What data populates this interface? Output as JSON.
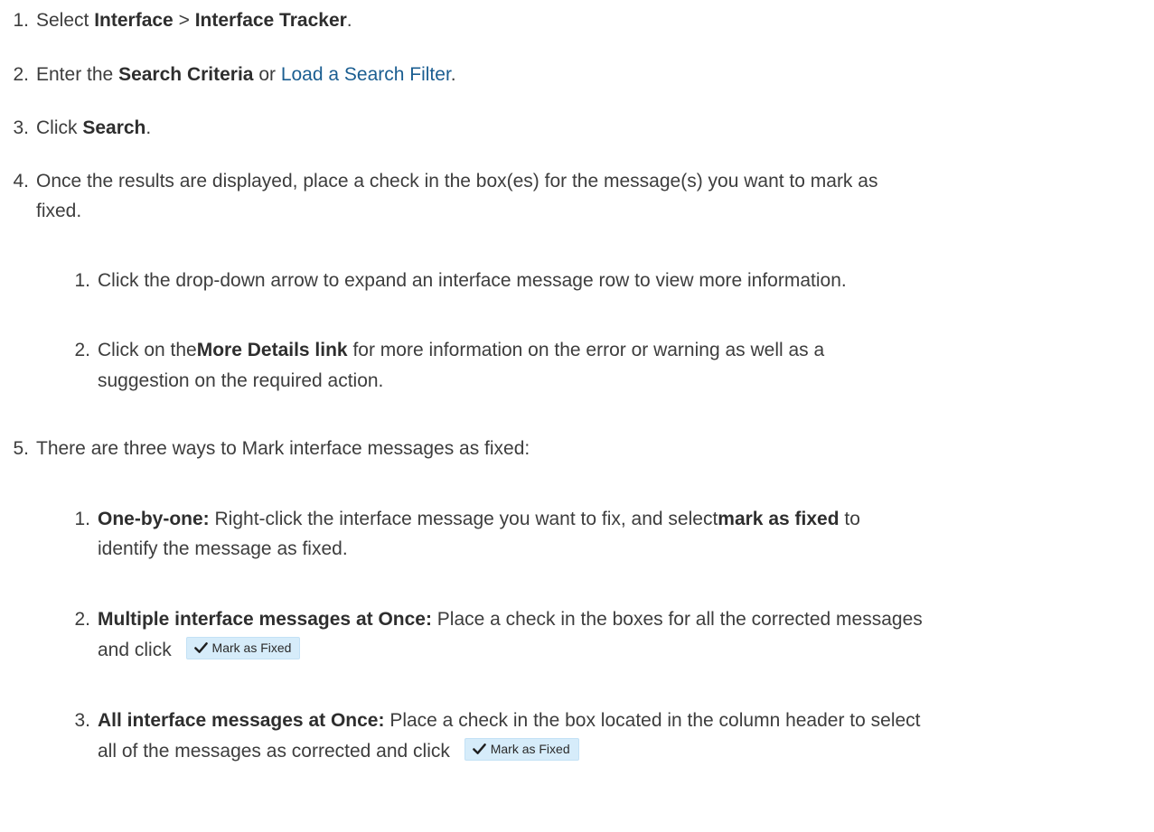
{
  "steps": [
    {
      "num": "1.",
      "pre": "Select ",
      "b1": "Interface",
      "mid": " > ",
      "b2": "Interface Tracker",
      "post": "."
    },
    {
      "num": "2.",
      "pre": "Enter the ",
      "b1": "Search Criteria",
      "mid": " or ",
      "link": "Load a Search Filter",
      "post": "."
    },
    {
      "num": "3.",
      "pre": "Click ",
      "b1": "Search",
      "post": "."
    },
    {
      "num": "4.",
      "line1": "Once the results are displayed, place a check in the box(es) for the message(s) you want to mark as",
      "line2": "fixed.",
      "sub": [
        {
          "num": "1.",
          "text": "Click the drop-down arrow to expand an interface message row to view more information."
        },
        {
          "num": "2.",
          "pre": "Click on the",
          "b1": "More Details link",
          "post1": " for more information on the error or warning as well as a",
          "line2": "suggestion on the required action."
        }
      ]
    },
    {
      "num": "5.",
      "text": "There are three ways to Mark interface messages as fixed:",
      "sub": [
        {
          "num": "1.",
          "b1": "One-by-one:",
          "post1": " Right-click the interface message you want to fix, and select",
          "b2": "mark as fixed",
          "post2": " to",
          "line2": "identify the message as fixed."
        },
        {
          "num": "2.",
          "b1": "Multiple interface messages at Once:",
          "post1": " Place a check in the boxes for all the corrected messages",
          "line2": "and click"
        },
        {
          "num": "3.",
          "b1": "All interface messages at Once:",
          "post1": " Place a check in the box located in the column header to select",
          "line2": "all of the messages as corrected and click"
        }
      ]
    }
  ],
  "mark_fixed_button": {
    "label": "Mark as Fixed",
    "icon": "check-icon",
    "bg": "#d6ecfa"
  },
  "colors": {
    "text": "#3d3d3d",
    "link": "#1b5e91"
  }
}
